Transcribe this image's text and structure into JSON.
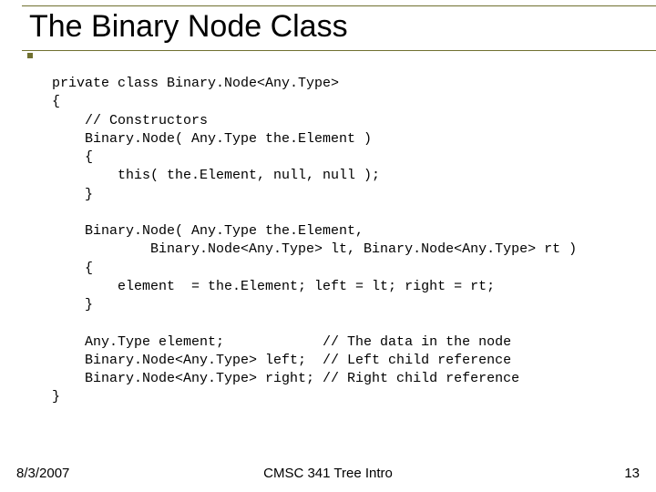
{
  "title": "The Binary Node Class",
  "code": "private class Binary.Node<Any.Type>\n{\n    // Constructors\n    Binary.Node( Any.Type the.Element )\n    {\n        this( the.Element, null, null );\n    }\n\n    Binary.Node( Any.Type the.Element,\n            Binary.Node<Any.Type> lt, Binary.Node<Any.Type> rt )\n    {\n        element  = the.Element; left = lt; right = rt;\n    }\n\n    Any.Type element;            // The data in the node\n    Binary.Node<Any.Type> left;  // Left child reference\n    Binary.Node<Any.Type> right; // Right child reference\n}",
  "footer": {
    "date": "8/3/2007",
    "center": "CMSC 341 Tree Intro",
    "page": "13"
  }
}
